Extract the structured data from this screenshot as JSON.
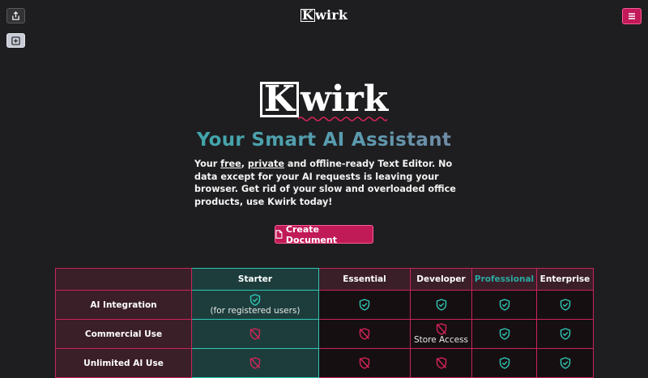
{
  "header": {
    "brand_k": "K",
    "brand_rest": "wirk",
    "share_icon": "share-icon",
    "add_icon": "plus-square-icon",
    "menu_icon": "hamburger-menu-icon"
  },
  "hero": {
    "logo_k": "K",
    "logo_rest": "wirk",
    "title": "Your Smart AI Assistant",
    "desc_prefix": "Your ",
    "desc_free": "free",
    "desc_sep": ", ",
    "desc_private": "private",
    "desc_rest": " and offline-ready Text Editor. No data except for your AI requests is leaving your browser. Get rid of your slow and overloaded office products, use Kwirk today!",
    "cta_label": "Create Document",
    "cta_icon": "document-icon"
  },
  "colors": {
    "background": "#1e1e20",
    "accent": "#c01a57",
    "teal": "#2fc8b5",
    "check_color": "#2fc8b5",
    "cross_color": "#d42458"
  },
  "table": {
    "columns": [
      "",
      "Starter",
      "Essential",
      "Developer",
      "Professional",
      "Enterprise"
    ],
    "rows": [
      {
        "label": "AI Integration",
        "cells": [
          {
            "icon": "shield-check-icon",
            "note": "(for registered users)"
          },
          {
            "icon": "shield-check-icon",
            "note": ""
          },
          {
            "icon": "shield-check-icon",
            "note": ""
          },
          {
            "icon": "shield-check-icon",
            "note": ""
          },
          {
            "icon": "shield-check-icon",
            "note": ""
          }
        ]
      },
      {
        "label": "Commercial Use",
        "cells": [
          {
            "icon": "shield-off-icon",
            "note": ""
          },
          {
            "icon": "shield-off-icon",
            "note": ""
          },
          {
            "icon": "shield-off-icon",
            "note": "Store Access"
          },
          {
            "icon": "shield-check-icon",
            "note": ""
          },
          {
            "icon": "shield-check-icon",
            "note": ""
          }
        ]
      },
      {
        "label": "Unlimited AI Use",
        "cells": [
          {
            "icon": "shield-off-icon",
            "note": ""
          },
          {
            "icon": "shield-off-icon",
            "note": ""
          },
          {
            "icon": "shield-off-icon",
            "note": ""
          },
          {
            "icon": "shield-check-icon",
            "note": ""
          },
          {
            "icon": "shield-check-icon",
            "note": ""
          }
        ]
      }
    ]
  }
}
